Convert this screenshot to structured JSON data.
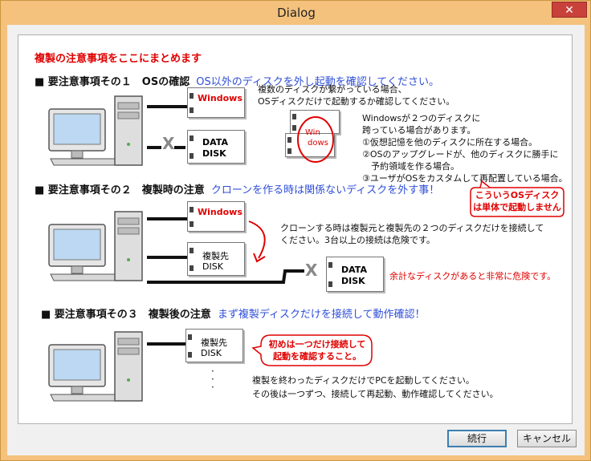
{
  "window": {
    "title": "Dialog",
    "close_glyph": "✕"
  },
  "heading": "複製の注意事項をここにまとめます",
  "section1": {
    "title": "■ 要注意事項その１　OSの確認",
    "note": "OS以外のディスクを外し起動を確認してください。",
    "disk_windows": "Windows",
    "disk_data_1": "DATA",
    "disk_data_2": "DISK",
    "x_mark": "X",
    "win_dows_1": "Win",
    "win_dows_2": "dows",
    "text_lines": [
      "複数のディスクが繋がっている場合、",
      "OSディスクだけで起動するか確認してください。"
    ],
    "text_lines2": [
      "Windowsが２つのディスクに",
      "跨っている場合があります。",
      "①仮想記憶を他のディスクに所在する場合。",
      "②OSのアップグレードが、他のディスクに勝手に",
      "　予約領域を作る場合。",
      "③ユーザがOSをカスタムして再配置している場合。"
    ]
  },
  "callout_os": [
    "こういうOSディスク",
    "は単体で起動しません"
  ],
  "section2": {
    "title": "■ 要注意事項その２　複製時の注意",
    "note": "クローンを作る時は関係ないディスクを外す事！",
    "disk_windows": "Windows",
    "disk_copy_1": "複製先",
    "disk_copy_2": "DISK",
    "disk_data_1": "DATA",
    "disk_data_2": "DISK",
    "x_mark": "X",
    "text_lines": [
      "クローンする時は複製元と複製先の２つのディスクだけを接続して",
      "ください。3台以上の接続は危険です。"
    ],
    "warning": "余計なディスクがあると非常に危険です。"
  },
  "section3": {
    "title": "■ 要注意事項その３　複製後の注意",
    "note": "まず複製ディスクだけを接続して動作確認！",
    "disk_copy_1": "複製先",
    "disk_copy_2": "DISK",
    "bubble": [
      "初めは一つだけ接続して",
      "起動を確認すること。"
    ],
    "text_lines": [
      "複製を終わったディスクだけでPCを起動してください。",
      "その後は一つずつ、接続して再起動、動作確認してください。"
    ]
  },
  "buttons": {
    "continue": "続行",
    "cancel": "キャンセル"
  }
}
